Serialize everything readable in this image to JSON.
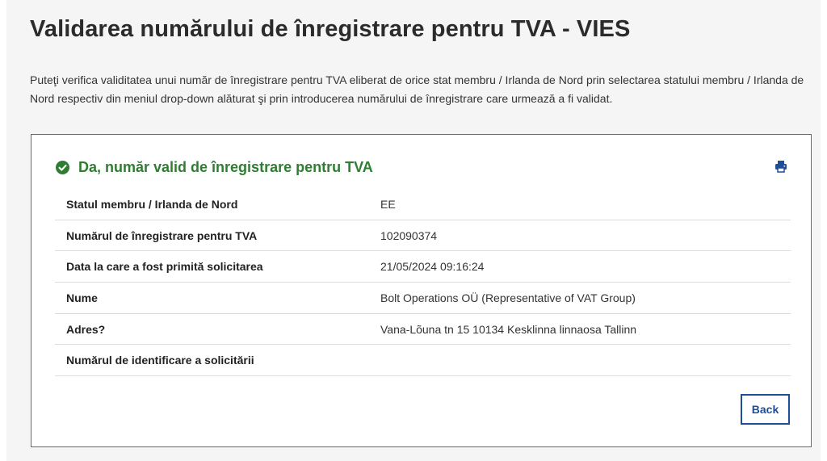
{
  "page": {
    "title": "Validarea numărului de înregistrare pentru TVA - VIES",
    "intro": "Puteţi verifica validitatea unui număr de înregistrare pentru TVA eliberat de orice stat membru / Irlanda de Nord prin selectarea statului membru / Irlanda de Nord respectiv din meniul drop-down alăturat şi prin introducerea numărului de înregistrare care urmează a fi validat."
  },
  "result": {
    "status_text": "Da, număr valid de înregistrare pentru TVA",
    "status_color": "#2f7d32",
    "status_icon": "check-circle-icon",
    "print_icon": "print-icon",
    "rows": [
      {
        "label": "Statul membru / Irlanda de Nord",
        "value": "EE"
      },
      {
        "label": "Numărul de înregistrare pentru TVA",
        "value": "102090374"
      },
      {
        "label": "Data la care a fost primită solicitarea",
        "value": "21/05/2024 09:16:24"
      },
      {
        "label": "Nume",
        "value": "Bolt Operations OÜ (Representative of VAT Group)"
      },
      {
        "label": "Adres?",
        "value": "Vana-Lõuna tn 15 10134 Kesklinna linnaosa Tallinn"
      },
      {
        "label": "Numărul de identificare a solicitării",
        "value": ""
      }
    ],
    "back_label": "Back",
    "accent_color": "#1f4e99"
  }
}
